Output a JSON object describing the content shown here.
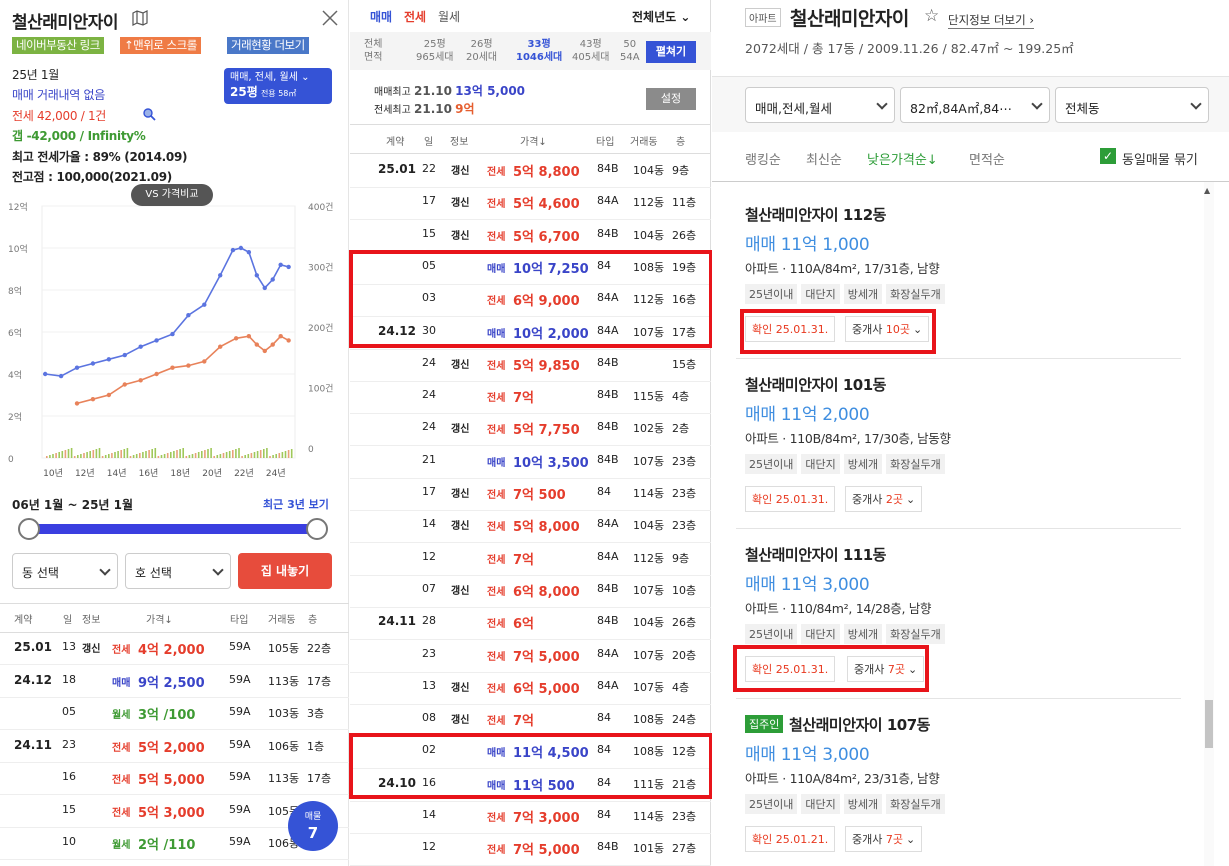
{
  "left": {
    "title": "철산래미안자이",
    "tags": [
      "네이버부동산 링크",
      "↑맨위로 스크롤",
      "거래현황 더보기"
    ],
    "info": {
      "month": "25년 1월",
      "sale": "매매 거래내역 없음",
      "jeonse": "전세 42,000 / 1건",
      "gap": "갭 -42,000 / Infinity%",
      "max_ratio": "최고 전세가율 : 89% (2014.09)",
      "high_point": "전고점 : 100,000(2021.09)"
    },
    "filter_badge": {
      "line1": "매매, 전세, 월세",
      "line2": "25평",
      "line2_sub": "전용 58㎡"
    },
    "vs_label": "VS 가격비교",
    "range_label": "06년 1월 ~ 25년 1월",
    "recent_label": "최근 3년 보기",
    "dong_select": "동 선택",
    "ho_select": "호 선택",
    "list_button": "집 내놓기",
    "table_headers": [
      "계약",
      "일",
      "정보",
      "가격↓",
      "타입",
      "거래동",
      "층"
    ],
    "rows": [
      {
        "ym": "25.01",
        "d": "13",
        "info": "갱신",
        "type": "전세",
        "price": "4억 2,000",
        "t": "59A",
        "dong": "105동",
        "fl": "22층"
      },
      {
        "ym": "24.12",
        "d": "18",
        "info": "",
        "type": "매매",
        "price": "9억 2,500",
        "t": "59A",
        "dong": "113동",
        "fl": "17층"
      },
      {
        "ym": "",
        "d": "05",
        "info": "",
        "type": "월세",
        "price": "3억 /100",
        "t": "59A",
        "dong": "103동",
        "fl": "3층"
      },
      {
        "ym": "24.11",
        "d": "23",
        "info": "",
        "type": "전세",
        "price": "5억 2,000",
        "t": "59A",
        "dong": "106동",
        "fl": "1층"
      },
      {
        "ym": "",
        "d": "16",
        "info": "",
        "type": "전세",
        "price": "5억 5,000",
        "t": "59A",
        "dong": "113동",
        "fl": "17층"
      },
      {
        "ym": "",
        "d": "15",
        "info": "",
        "type": "전세",
        "price": "5억 3,000",
        "t": "59A",
        "dong": "105동",
        "fl": ""
      },
      {
        "ym": "",
        "d": "10",
        "info": "",
        "type": "월세",
        "price": "2억 /110",
        "t": "59A",
        "dong": "106동",
        "fl": ""
      }
    ],
    "fab": {
      "label": "매물",
      "count": "7"
    }
  },
  "chart_data": {
    "type": "line",
    "x_ticks": [
      "10년",
      "12년",
      "14년",
      "16년",
      "18년",
      "20년",
      "22년",
      "24년"
    ],
    "y_left_ticks": [
      "12억",
      "10억",
      "8억",
      "6억",
      "4억",
      "2억",
      "0"
    ],
    "y_right_ticks": [
      "400건",
      "300건",
      "200건",
      "100건",
      "0"
    ],
    "ylim": [
      0,
      12
    ],
    "series": [
      {
        "color": "#5b74e0",
        "x": [
          2009.5,
          2010.5,
          2011.5,
          2012.5,
          2013.5,
          2014.5,
          2015.5,
          2016.5,
          2017.5,
          2018.5,
          2019.5,
          2020.5,
          2021.3,
          2021.8,
          2022.3,
          2022.8,
          2023.3,
          2023.8,
          2024.3,
          2024.8
        ],
        "y": [
          4.0,
          3.9,
          4.3,
          4.5,
          4.7,
          4.9,
          5.3,
          5.6,
          5.9,
          6.8,
          7.3,
          8.7,
          9.9,
          10.0,
          9.8,
          8.7,
          8.1,
          8.5,
          9.2,
          9.1
        ]
      },
      {
        "color": "#e8825a",
        "x": [
          2011.5,
          2012.5,
          2013.5,
          2014.5,
          2015.5,
          2016.5,
          2017.5,
          2018.5,
          2019.5,
          2020.5,
          2021.5,
          2022.3,
          2022.8,
          2023.3,
          2023.8,
          2024.3,
          2024.8
        ],
        "y": [
          2.6,
          2.8,
          3.0,
          3.5,
          3.7,
          4.0,
          4.3,
          4.4,
          4.6,
          5.3,
          5.7,
          5.8,
          5.4,
          5.1,
          5.4,
          5.8,
          5.6
        ]
      }
    ]
  },
  "middle": {
    "tabs": [
      "매매",
      "전세",
      "월세"
    ],
    "year_select": "전체년도",
    "pyeong_row1": [
      "전체",
      "25평",
      "26평",
      "33평",
      "43평",
      "50"
    ],
    "pyeong_row2": [
      "면적",
      "965세대",
      "20세대",
      "1046세대",
      "405세대",
      "54A"
    ],
    "spread": "펼쳐기",
    "sale_max_label": "매매최고",
    "sale_max_date": "21.10",
    "sale_max_price": "13억 5,000",
    "jeonse_max_label": "전세최고",
    "jeonse_max_date": "21.10",
    "jeonse_max_price": "9억",
    "setting": "설정",
    "headers": [
      "계약",
      "일",
      "정보",
      "가격↓",
      "타입",
      "거래동",
      "층"
    ],
    "rows": [
      {
        "ym": "25.01",
        "d": "22",
        "info": "갱신",
        "type": "전세",
        "price": "5억 8,800",
        "t": "84B",
        "dong": "104동",
        "fl": "9층"
      },
      {
        "ym": "",
        "d": "17",
        "info": "갱신",
        "type": "전세",
        "price": "5억 4,600",
        "t": "84A",
        "dong": "112동",
        "fl": "11층"
      },
      {
        "ym": "",
        "d": "15",
        "info": "갱신",
        "type": "전세",
        "price": "5억 6,700",
        "t": "84B",
        "dong": "104동",
        "fl": "26층"
      },
      {
        "ym": "",
        "d": "05",
        "info": "",
        "type": "매매",
        "price": "10억 7,250",
        "t": "84",
        "dong": "108동",
        "fl": "19층"
      },
      {
        "ym": "",
        "d": "03",
        "info": "",
        "type": "전세",
        "price": "6억 9,000",
        "t": "84A",
        "dong": "112동",
        "fl": "16층"
      },
      {
        "ym": "24.12",
        "d": "30",
        "info": "",
        "type": "매매",
        "price": "10억 2,000",
        "t": "84A",
        "dong": "107동",
        "fl": "17층"
      },
      {
        "ym": "",
        "d": "24",
        "info": "갱신",
        "type": "전세",
        "price": "5억 9,850",
        "t": "84B",
        "dong": "",
        "fl": "15층"
      },
      {
        "ym": "",
        "d": "24",
        "info": "",
        "type": "전세",
        "price": "7억",
        "t": "84B",
        "dong": "115동",
        "fl": "4층"
      },
      {
        "ym": "",
        "d": "24",
        "info": "갱신",
        "type": "전세",
        "price": "5억 7,750",
        "t": "84B",
        "dong": "102동",
        "fl": "2층"
      },
      {
        "ym": "",
        "d": "21",
        "info": "",
        "type": "매매",
        "price": "10억 3,500",
        "t": "84B",
        "dong": "107동",
        "fl": "23층"
      },
      {
        "ym": "",
        "d": "17",
        "info": "갱신",
        "type": "전세",
        "price": "7억 500",
        "t": "84",
        "dong": "114동",
        "fl": "23층"
      },
      {
        "ym": "",
        "d": "14",
        "info": "갱신",
        "type": "전세",
        "price": "5억 8,000",
        "t": "84A",
        "dong": "104동",
        "fl": "23층"
      },
      {
        "ym": "",
        "d": "12",
        "info": "",
        "type": "전세",
        "price": "7억",
        "t": "84A",
        "dong": "112동",
        "fl": "9층"
      },
      {
        "ym": "",
        "d": "07",
        "info": "갱신",
        "type": "전세",
        "price": "6억 8,000",
        "t": "84B",
        "dong": "107동",
        "fl": "10층"
      },
      {
        "ym": "24.11",
        "d": "28",
        "info": "",
        "type": "전세",
        "price": "6억",
        "t": "84B",
        "dong": "104동",
        "fl": "26층"
      },
      {
        "ym": "",
        "d": "23",
        "info": "",
        "type": "전세",
        "price": "7억 5,000",
        "t": "84A",
        "dong": "107동",
        "fl": "20층"
      },
      {
        "ym": "",
        "d": "13",
        "info": "갱신",
        "type": "전세",
        "price": "6억 5,000",
        "t": "84A",
        "dong": "107동",
        "fl": "4층"
      },
      {
        "ym": "",
        "d": "08",
        "info": "갱신",
        "type": "전세",
        "price": "7억",
        "t": "84",
        "dong": "108동",
        "fl": "24층"
      },
      {
        "ym": "",
        "d": "02",
        "info": "",
        "type": "매매",
        "price": "11억 4,500",
        "t": "84",
        "dong": "108동",
        "fl": "12층"
      },
      {
        "ym": "24.10",
        "d": "16",
        "info": "",
        "type": "매매",
        "price": "11억 500",
        "t": "84",
        "dong": "111동",
        "fl": "21층"
      },
      {
        "ym": "",
        "d": "14",
        "info": "",
        "type": "전세",
        "price": "7억 3,000",
        "t": "84",
        "dong": "114동",
        "fl": "23층"
      },
      {
        "ym": "",
        "d": "12",
        "info": "",
        "type": "전세",
        "price": "7억 5,000",
        "t": "84B",
        "dong": "101동",
        "fl": "27층"
      }
    ]
  },
  "right": {
    "badge": "아파트",
    "title": "철산래미안자이",
    "complex_link": "단지정보 더보기",
    "summary": "2072세대 / 총 17동 / 2009.11.26 / 82.47㎡ ~ 199.25㎡",
    "filter1": "매매,전세,월세",
    "filter2": "82㎡,84A㎡,84⋯",
    "filter3": "전체동",
    "sorts": [
      "랭킹순",
      "최신순",
      "낮은가격순↓",
      "면적순"
    ],
    "group_label": "동일매물 묶기",
    "listings": [
      {
        "owner": "",
        "name": "철산래미안자이 112동",
        "price": "매매 11억 1,000",
        "desc": "아파트 · 110A/84m², 17/31층, 남향",
        "chips": [
          "25년이내",
          "대단지",
          "방세개",
          "화장실두개"
        ],
        "verify": "확인 25.01.31.",
        "agent": "중개사 ",
        "agent_count": "10곳"
      },
      {
        "owner": "",
        "name": "철산래미안자이 101동",
        "price": "매매 11억 2,000",
        "desc": "아파트 · 110B/84m², 17/30층, 남동향",
        "chips": [
          "25년이내",
          "대단지",
          "방세개",
          "화장실두개"
        ],
        "verify": "확인 25.01.31.",
        "agent": "중개사 ",
        "agent_count": "2곳"
      },
      {
        "owner": "",
        "name": "철산래미안자이 111동",
        "price": "매매 11억 3,000",
        "desc": "아파트 · 110/84m², 14/28층, 남향",
        "chips": [
          "25년이내",
          "대단지",
          "방세개",
          "화장실두개"
        ],
        "verify": "확인 25.01.31.",
        "agent": "중개사 ",
        "agent_count": "7곳"
      },
      {
        "owner": "집주인",
        "name": "철산래미안자이 107동",
        "price": "매매 11억 3,000",
        "desc": "아파트 · 110A/84m², 23/31층, 남향",
        "chips": [
          "25년이내",
          "대단지",
          "방세개",
          "화장실두개"
        ],
        "verify": "확인 25.01.21.",
        "agent": "중개사 ",
        "agent_count": "7곳"
      }
    ]
  },
  "colors": {
    "sale": "#3a45c8",
    "jeonse": "#e53d2c",
    "monthly": "#3e9a33",
    "highlight": "#e8141a",
    "accent": "#3553d6"
  }
}
